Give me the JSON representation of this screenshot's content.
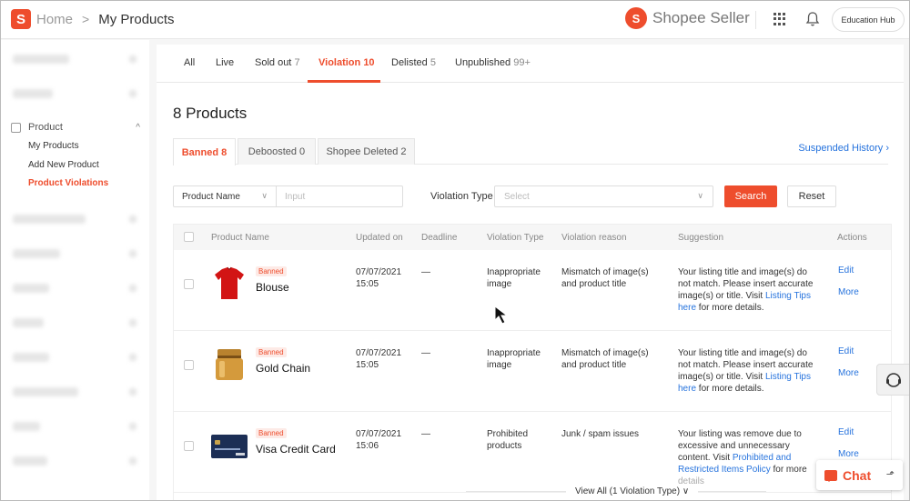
{
  "header": {
    "logo_letter": "S",
    "breadcrumb_home": "Home",
    "breadcrumb_sep": ">",
    "breadcrumb_current": "My Products",
    "brand_icon_letter": "S",
    "brand_name": "Shopee Seller",
    "education_hub": "Education Hub"
  },
  "sidebar": {
    "section": "Product",
    "section_chevron": "^",
    "items": [
      {
        "label": "My Products"
      },
      {
        "label": "Add New Product"
      },
      {
        "label": "Product Violations"
      }
    ]
  },
  "tabs": [
    {
      "label": "All",
      "count": ""
    },
    {
      "label": "Live",
      "count": ""
    },
    {
      "label": "Sold out",
      "count": "7"
    },
    {
      "label": "Violation",
      "count": "10"
    },
    {
      "label": "Delisted",
      "count": "5"
    },
    {
      "label": "Unpublished",
      "count": "99+"
    }
  ],
  "products_title": "8 Products",
  "subtabs": [
    {
      "label": "Banned 8"
    },
    {
      "label": "Deboosted 0"
    },
    {
      "label": "Shopee Deleted 2"
    }
  ],
  "suspended_history": "Suspended History",
  "filter": {
    "field": "Product Name",
    "input_placeholder": "Input",
    "violation_type_label": "Violation Type",
    "violation_type_placeholder": "Select",
    "search": "Search",
    "reset": "Reset"
  },
  "table": {
    "columns": [
      "Product Name",
      "Updated on",
      "Deadline",
      "Violation Type",
      "Violation reason",
      "Suggestion",
      "Actions"
    ],
    "rows": [
      {
        "badge": "Banned",
        "name": "Blouse",
        "date": "07/07/2021",
        "time": "15:05",
        "deadline": "—",
        "type1": "Inappropriate",
        "type2": "image",
        "reason1": "Mismatch of image(s)",
        "reason2": "and product title",
        "sugg1": "Your listing title and image(s) do",
        "sugg2": "not match. Please insert accurate",
        "sugg3": "image(s) or title. Visit ",
        "sugg_link1": "Listing Tips",
        "sugg_link2": "here",
        "sugg4": " for more details.",
        "edit": "Edit",
        "more": "More"
      },
      {
        "badge": "Banned",
        "name": "Gold Chain",
        "date": "07/07/2021",
        "time": "15:05",
        "deadline": "—",
        "type1": "Inappropriate",
        "type2": "image",
        "reason1": "Mismatch of image(s)",
        "reason2": "and product title",
        "sugg1": "Your listing title and image(s) do",
        "sugg2": "not match. Please insert accurate",
        "sugg3": "image(s) or title. Visit ",
        "sugg_link1": "Listing Tips",
        "sugg_link2": "here",
        "sugg4": " for more details.",
        "edit": "Edit",
        "more": "More"
      },
      {
        "badge": "Banned",
        "name": "Visa Credit Card",
        "date": "07/07/2021",
        "time": "15:06",
        "deadline": "—",
        "type1": "Prohibited",
        "type2": "products",
        "reason1": "Junk / spam issues",
        "reason2": "",
        "sugg1": "Your listing was remove due to",
        "sugg2": "excessive and unnecessary",
        "sugg3": "content. Visit ",
        "sugg_link1": "Prohibited and",
        "sugg_link2": "Restricted Items Policy",
        "sugg4": " for more",
        "sugg5": "details",
        "edit": "Edit",
        "more": "More"
      }
    ]
  },
  "view_all": "View All (1 Violation Type)",
  "chat": "Chat",
  "colors": {
    "accent": "#ee4d2d",
    "link": "#2673dd"
  }
}
